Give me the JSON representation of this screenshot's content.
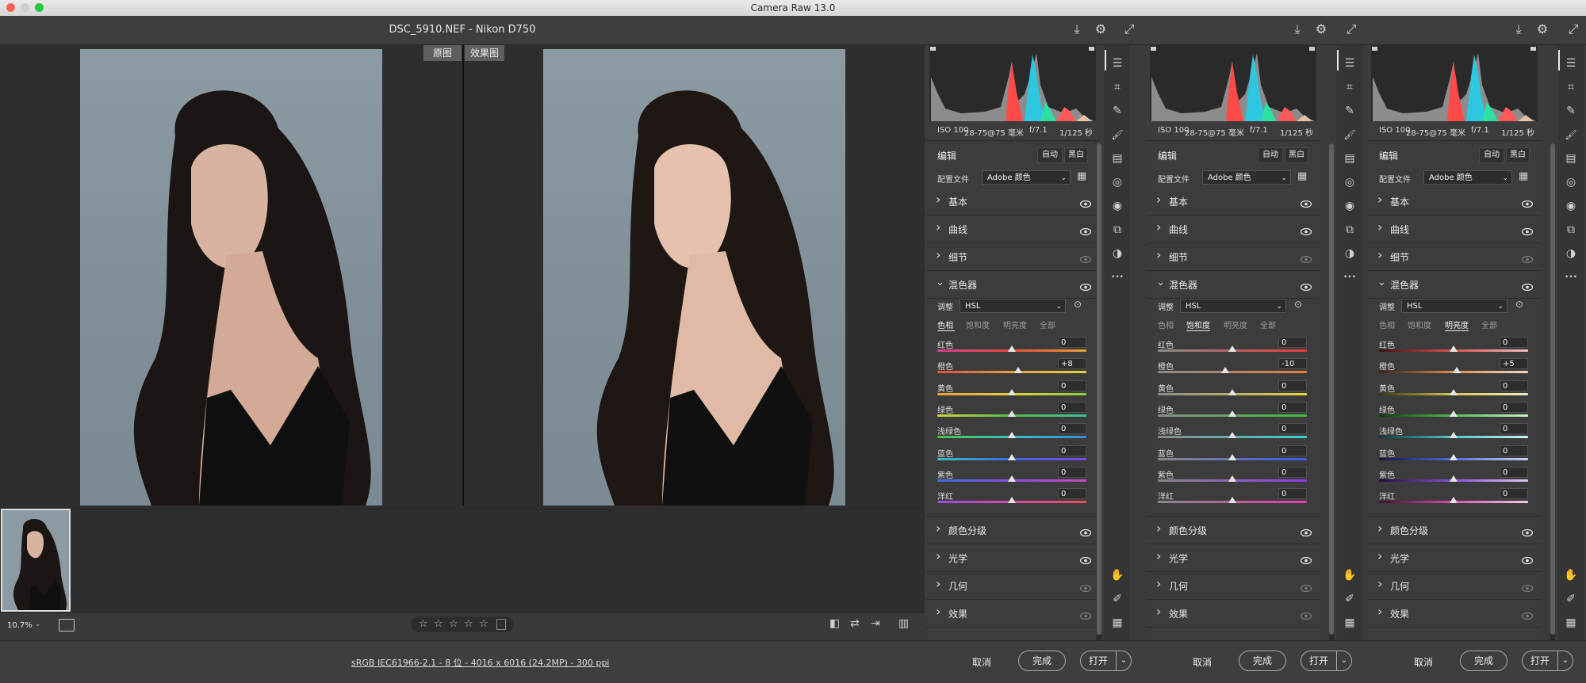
{
  "window": {
    "title": "Camera Raw 13.0",
    "traffic_colors": [
      "#fd5f57",
      "#d0d0d0",
      "#27c93f"
    ]
  },
  "header": {
    "file_title": "DSC_5910.NEF -  Nikon D750"
  },
  "preview": {
    "tags": [
      "原图",
      "效果图"
    ],
    "zoom": "10.7%",
    "stars": [
      "☆",
      "☆",
      "☆",
      "☆",
      "☆"
    ]
  },
  "footer": {
    "image_info": "sRGB IEC61966-2.1 - 8 位 - 4016 x 6016 (24.2MP) - 300 ppi",
    "cancel": "取消",
    "done": "完成",
    "open": "打开"
  },
  "panels": [
    {
      "camera": {
        "iso": "ISO 100",
        "lens": "28-75@75 毫米",
        "aperture": "f/7.1",
        "shutter": "1/125 秒"
      },
      "edit_title": "编辑",
      "auto": "自动",
      "bw": "黑白",
      "profile_label": "配置文件",
      "profile_value": "Adobe 颜色",
      "sections_top": [
        "基本",
        "曲线",
        "细节"
      ],
      "mixer_title": "混色器",
      "adjust_label": "调整",
      "adjust_value": "HSL",
      "tabs": [
        "色相",
        "饱和度",
        "明亮度",
        "全部"
      ],
      "active_tab": 0,
      "sliders": [
        {
          "label": "红色",
          "value": "0",
          "pos": 0.5
        },
        {
          "label": "橙色",
          "value": "+8",
          "pos": 0.54
        },
        {
          "label": "黄色",
          "value": "0",
          "pos": 0.5
        },
        {
          "label": "绿色",
          "value": "0",
          "pos": 0.5
        },
        {
          "label": "浅绿色",
          "value": "0",
          "pos": 0.5
        },
        {
          "label": "蓝色",
          "value": "0",
          "pos": 0.5
        },
        {
          "label": "紫色",
          "value": "0",
          "pos": 0.5
        },
        {
          "label": "洋红",
          "value": "0",
          "pos": 0.5
        }
      ],
      "sections_bottom": [
        "颜色分级",
        "光学",
        "几何",
        "效果"
      ]
    },
    {
      "camera": {
        "iso": "ISO 100",
        "lens": "28-75@75 毫米",
        "aperture": "f/7.1",
        "shutter": "1/125 秒"
      },
      "edit_title": "编辑",
      "auto": "自动",
      "bw": "黑白",
      "profile_label": "配置文件",
      "profile_value": "Adobe 颜色",
      "sections_top": [
        "基本",
        "曲线",
        "细节"
      ],
      "mixer_title": "混色器",
      "adjust_label": "调整",
      "adjust_value": "HSL",
      "tabs": [
        "色相",
        "饱和度",
        "明亮度",
        "全部"
      ],
      "active_tab": 1,
      "sliders": [
        {
          "label": "红色",
          "value": "0",
          "pos": 0.5
        },
        {
          "label": "橙色",
          "value": "-10",
          "pos": 0.45
        },
        {
          "label": "黄色",
          "value": "0",
          "pos": 0.5
        },
        {
          "label": "绿色",
          "value": "0",
          "pos": 0.5
        },
        {
          "label": "浅绿色",
          "value": "0",
          "pos": 0.5
        },
        {
          "label": "蓝色",
          "value": "0",
          "pos": 0.5
        },
        {
          "label": "紫色",
          "value": "0",
          "pos": 0.5
        },
        {
          "label": "洋红",
          "value": "0",
          "pos": 0.5
        }
      ],
      "sections_bottom": [
        "颜色分级",
        "光学",
        "几何",
        "效果"
      ]
    },
    {
      "camera": {
        "iso": "ISO 100",
        "lens": "28-75@75 毫米",
        "aperture": "f/7.1",
        "shutter": "1/125 秒"
      },
      "edit_title": "编辑",
      "auto": "自动",
      "bw": "黑白",
      "profile_label": "配置文件",
      "profile_value": "Adobe 颜色",
      "sections_top": [
        "基本",
        "曲线",
        "细节"
      ],
      "mixer_title": "混色器",
      "adjust_label": "调整",
      "adjust_value": "HSL",
      "tabs": [
        "色相",
        "饱和度",
        "明亮度",
        "全部"
      ],
      "active_tab": 2,
      "sliders": [
        {
          "label": "红色",
          "value": "0",
          "pos": 0.5
        },
        {
          "label": "橙色",
          "value": "+5",
          "pos": 0.52
        },
        {
          "label": "黄色",
          "value": "0",
          "pos": 0.5
        },
        {
          "label": "绿色",
          "value": "0",
          "pos": 0.5
        },
        {
          "label": "浅绿色",
          "value": "0",
          "pos": 0.5
        },
        {
          "label": "蓝色",
          "value": "0",
          "pos": 0.5
        },
        {
          "label": "紫色",
          "value": "0",
          "pos": 0.5
        },
        {
          "label": "洋红",
          "value": "0",
          "pos": 0.5
        }
      ],
      "sections_bottom": [
        "颜色分级",
        "光学",
        "几何",
        "效果"
      ]
    }
  ],
  "tracks": {
    "hue": [
      "linear-gradient(90deg,#d63f8f,#e84a3a,#e8a03a)",
      "linear-gradient(90deg,#e84a3a,#e8a03a,#e8d03a)",
      "linear-gradient(90deg,#e8a03a,#e8d03a,#8ad03a)",
      "linear-gradient(90deg,#d8d03a,#4fc04a,#3ac0a0)",
      "linear-gradient(90deg,#4fc04a,#3ac0c0,#3a8ae0)",
      "linear-gradient(90deg,#3ac0c0,#3a6ae0,#7a4ae0)",
      "linear-gradient(90deg,#3a6ae0,#8a4ae0,#c84ac0)",
      "linear-gradient(90deg,#9a4ae0,#d84ab0,#e84a5a)"
    ],
    "sat": [
      "linear-gradient(90deg,#8a8a8a,#e83a3a)",
      "linear-gradient(90deg,#8a8a8a,#e8803a)",
      "linear-gradient(90deg,#8a8a8a,#e8d83a)",
      "linear-gradient(90deg,#8a8a8a,#3ac03a)",
      "linear-gradient(90deg,#8a8a8a,#3ad0d0)",
      "linear-gradient(90deg,#8a8a8a,#3a5ae8)",
      "linear-gradient(90deg,#8a8a8a,#8a3ae8)",
      "linear-gradient(90deg,#8a8a8a,#e83ab0)"
    ],
    "lum": [
      "linear-gradient(90deg,#3a1010,#e05050,#f0c0c0)",
      "linear-gradient(90deg,#3a2010,#e09050,#f0d8c0)",
      "linear-gradient(90deg,#3a3510,#d8c850,#f0ecc0)",
      "linear-gradient(90deg,#103a10,#50c050,#c8f0c8)",
      "linear-gradient(90deg,#103a3a,#50c8c8,#c8f0f0)",
      "linear-gradient(90deg,#10103a,#5070e0,#c8d0f0)",
      "linear-gradient(90deg,#20103a,#8a50e0,#dcc8f0)",
      "linear-gradient(90deg,#3a1030,#e050b0,#f0c8e4)"
    ]
  }
}
